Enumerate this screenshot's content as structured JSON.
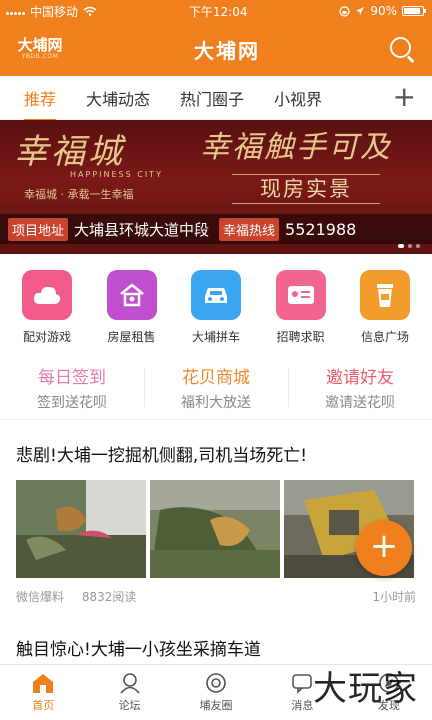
{
  "status": {
    "carrier": "中国移动",
    "time": "下午12:04",
    "battery": "90%"
  },
  "header": {
    "logo_text": "大埔网",
    "logo_sub": "YBDB.COM",
    "title": "大埔网"
  },
  "tabs": [
    {
      "label": "推荐",
      "active": true
    },
    {
      "label": "大埔动态",
      "active": false
    },
    {
      "label": "热门圈子",
      "active": false
    },
    {
      "label": "小视界",
      "active": false
    }
  ],
  "banner": {
    "headline_left": "幸福城",
    "headline_right": "幸福触手可及",
    "city_en": "HAPPINESS CITY",
    "slogan": "幸福城 · 承载一生幸福",
    "badge": "现房实景",
    "address_tag": "项目地址",
    "address": "大埔县环城大道中段",
    "hotline_tag": "幸福热线",
    "hotline": "5521988"
  },
  "grid": [
    {
      "label": "配对游戏",
      "icon": "cloud-icon",
      "color": "#f25a8a"
    },
    {
      "label": "房屋租售",
      "icon": "house-icon",
      "color": "#c04fd0"
    },
    {
      "label": "大埔拼车",
      "icon": "car-icon",
      "color": "#3aa6f0"
    },
    {
      "label": "招聘求职",
      "icon": "id-card-icon",
      "color": "#f2658f"
    },
    {
      "label": "信息广场",
      "icon": "cup-icon",
      "color": "#f39c2b"
    }
  ],
  "promos": [
    {
      "title": "每日签到",
      "sub": "签到送花呗",
      "color": "#e67ab0"
    },
    {
      "title": "花贝商城",
      "sub": "福利大放送",
      "color": "#ee8a2c"
    },
    {
      "title": "邀请好友",
      "sub": "邀请送花呗",
      "color": "#ec5c6c"
    }
  ],
  "article": {
    "title": "悲剧!大埔一挖掘机侧翻,司机当场死亡!",
    "source": "微信爆料",
    "reads": "8832阅读",
    "time": "1小时前"
  },
  "next_article": {
    "title": "触目惊心!大埔一小孩坐采摘车道"
  },
  "bottom_nav": [
    {
      "label": "首页",
      "icon": "home-icon",
      "active": true
    },
    {
      "label": "论坛",
      "icon": "forum-icon",
      "active": false
    },
    {
      "label": "埔友圈",
      "icon": "circle-icon",
      "active": false
    },
    {
      "label": "消息",
      "icon": "message-icon",
      "active": false
    },
    {
      "label": "发现",
      "icon": "discover-icon",
      "active": false
    }
  ],
  "watermark": "大玩家",
  "colors": {
    "accent": "#f0801e"
  }
}
